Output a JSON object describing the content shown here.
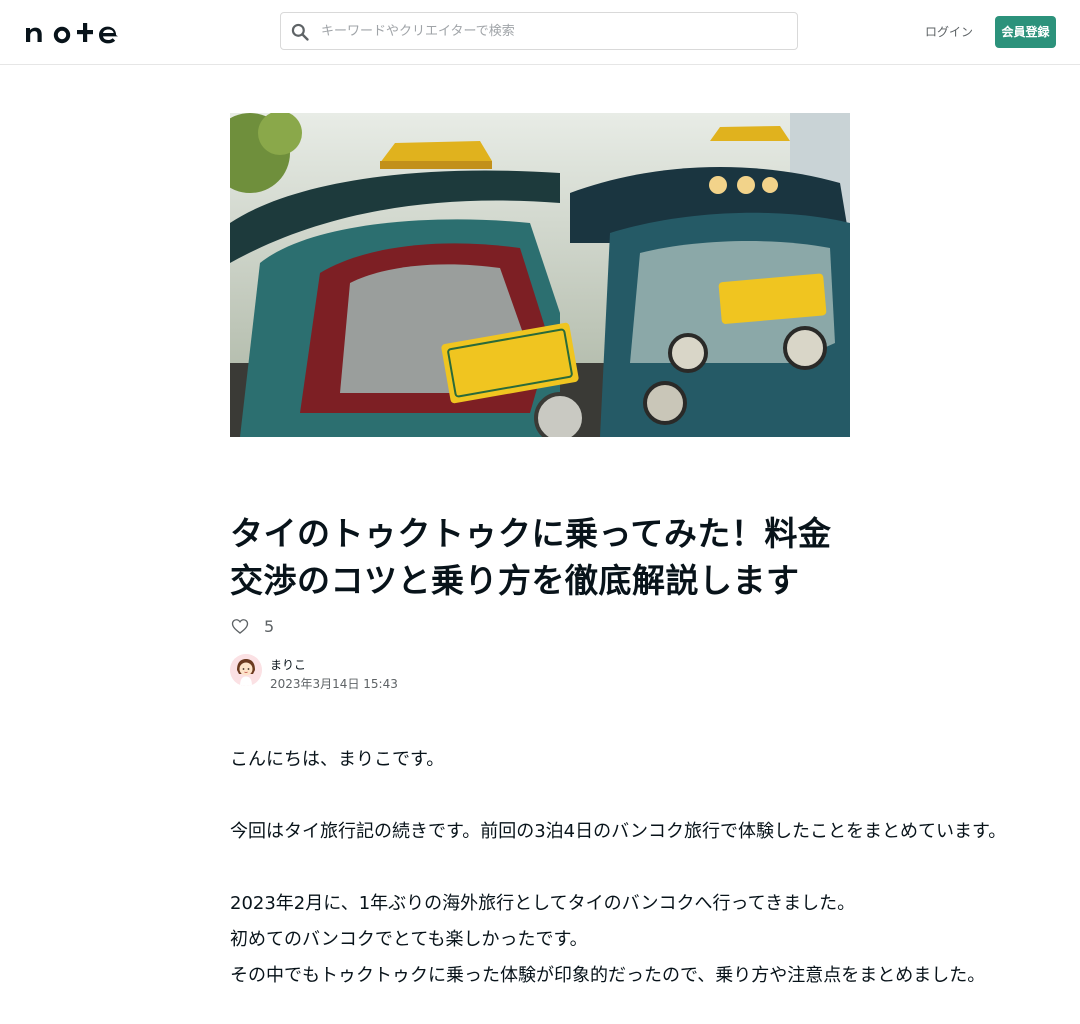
{
  "header": {
    "logo_alt": "note",
    "search_placeholder": "キーワードやクリエイターで検索",
    "login_label": "ログイン",
    "signup_label": "会員登録"
  },
  "hero": {
    "image_icon": "tuk-tuk-taxi-photo"
  },
  "article": {
    "title": "タイのトゥクトゥクに乗ってみた！料金交渉のコツと乗り方を徹底解説します",
    "like_count": "5",
    "author_name": "まりこ",
    "date": "2023年3月14日 15:43",
    "paragraphs": [
      "こんにちは、まりこです。",
      "",
      "今回はタイ旅行記の続きです。前回の3泊4日のバンコク旅行で体験したことをまとめています。",
      "",
      "2023年2月に、1年ぶりの海外旅行としてタイのバンコクへ行ってきました。",
      "初めてのバンコクでとても楽しかったです。",
      "その中でもトゥクトゥクに乗った体験が印象的だったので、乗り方や注意点をまとめました。"
    ]
  },
  "colors": {
    "accent": "#2c927b",
    "text": "#08131a",
    "muted": "#5e6366"
  }
}
